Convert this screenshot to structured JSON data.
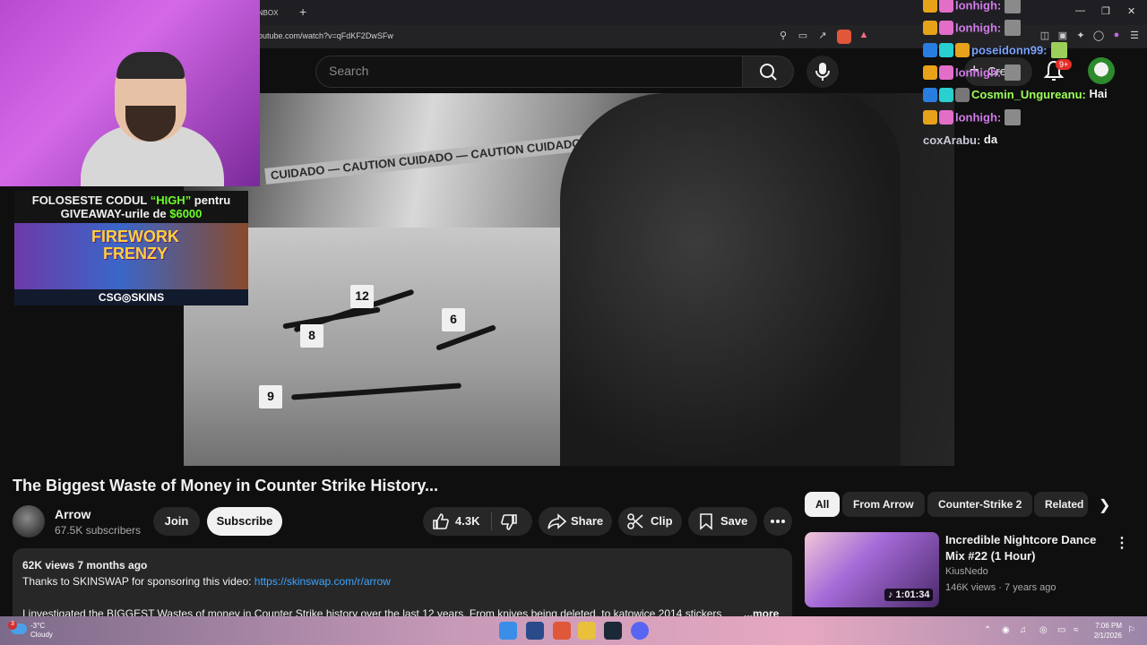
{
  "browser": {
    "tab_label": "UNBOX",
    "new_tab": "+",
    "url": "outube.com/watch?v=qFdKF2DwSFw"
  },
  "header": {
    "search_placeholder": "Search",
    "create_label": "Creat",
    "notifications": "9+"
  },
  "webcam_overlay": {
    "promo_line1_prefix": "FOLOSESTE CODUL ",
    "promo_code": "“HIGH”",
    "promo_line1_suffix": " pentru",
    "promo_line2_prefix": "GIVEAWAY-urile de ",
    "promo_amount": "$6000",
    "promo_title": "FIREWORK FRENZY",
    "promo_brand": "CSG◎SKINS"
  },
  "chat": [
    {
      "user": "lonhigh:",
      "message": ""
    },
    {
      "user": "lonhigh:",
      "message": ""
    },
    {
      "user": "poseidonn99:",
      "message": ""
    },
    {
      "user": "lonhigh:",
      "message": ""
    },
    {
      "user": "Cosmin_Ungureanu:",
      "message": "Hai"
    },
    {
      "user": "lonhigh:",
      "message": ""
    },
    {
      "user": "coxArabu:",
      "message": "da"
    }
  ],
  "video": {
    "tape_text": "CUIDADO — CAUTION CUIDADO — CAUTION CUIDADO — CAUTION",
    "markers": [
      "12",
      "6",
      "8",
      "9"
    ],
    "title": "The Biggest Waste of Money in Counter Strike History...",
    "channel": "Arrow",
    "subscribers": "67.5K subscribers",
    "join_label": "Join",
    "subscribe_label": "Subscribe",
    "likes": "4.3K",
    "share_label": "Share",
    "clip_label": "Clip",
    "save_label": "Save"
  },
  "description": {
    "meta": "62K views  7 months ago",
    "line1": "Thanks to SKINSWAP for sponsoring this video: ",
    "link": "https://skinswap.com/r/arrow",
    "line2": "I investigated the BIGGEST Wastes of money in Counter Strike history over the last 12 years. From knives being deleted, to katowice 2014 stickers",
    "more": "...more"
  },
  "chips": [
    "All",
    "From Arrow",
    "Counter-Strike 2",
    "Related"
  ],
  "recommended": {
    "title": "Incredible Nightcore Dance Mix #22 (1 Hour)",
    "channel": "KiusNedo",
    "meta": "146K views · 7 years ago",
    "duration": "♪ 1:01:34"
  },
  "taskbar": {
    "weather_temp": "-3°C",
    "weather_desc": "Cloudy",
    "weather_badge": "3",
    "time": "7:06 PM",
    "date": "2/1/2026"
  },
  "colors": {
    "background": "#0f0f0f",
    "pill": "#272727",
    "link": "#3ea6ff",
    "promo_green": "#6cff2a"
  }
}
